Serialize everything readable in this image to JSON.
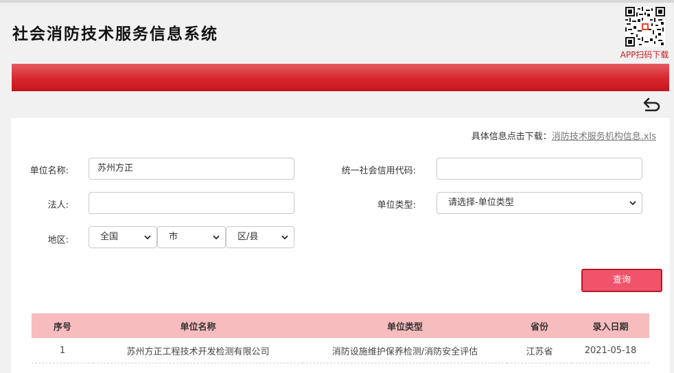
{
  "header": {
    "title": "社会消防技术服务信息系统",
    "app_download_label": "APP扫码下载"
  },
  "icons": {
    "qr": "qr-code",
    "back": "back-arrow-icon",
    "select_chevron": "chevron-down-icon"
  },
  "colors": {
    "banner": "#d7272e",
    "accent": "#f0546a",
    "table_header": "#f7bcbe",
    "download_label": "#d01820"
  },
  "download": {
    "prefix": "具体信息点击下载：",
    "link_text": "消防技术服务机构信息.xls"
  },
  "form": {
    "unit_name": {
      "label": "单位名称:",
      "value": "苏州方正"
    },
    "credit_code": {
      "label": "统一社会信用代码:",
      "value": ""
    },
    "legal_person": {
      "label": "法人:",
      "value": ""
    },
    "unit_type": {
      "label": "单位类型:",
      "selected": "请选择-单位类型"
    },
    "region": {
      "label": "地区:",
      "province": "全国",
      "city": "市",
      "district": "区/县"
    },
    "query_button": "查询"
  },
  "table": {
    "columns": [
      "序号",
      "单位名称",
      "单位类型",
      "省份",
      "录入日期"
    ],
    "rows": [
      [
        "1",
        "苏州方正工程技术开发检测有限公司",
        "消防设施维护保养检测/消防安全评估",
        "江苏省",
        "2021-05-18"
      ]
    ]
  }
}
